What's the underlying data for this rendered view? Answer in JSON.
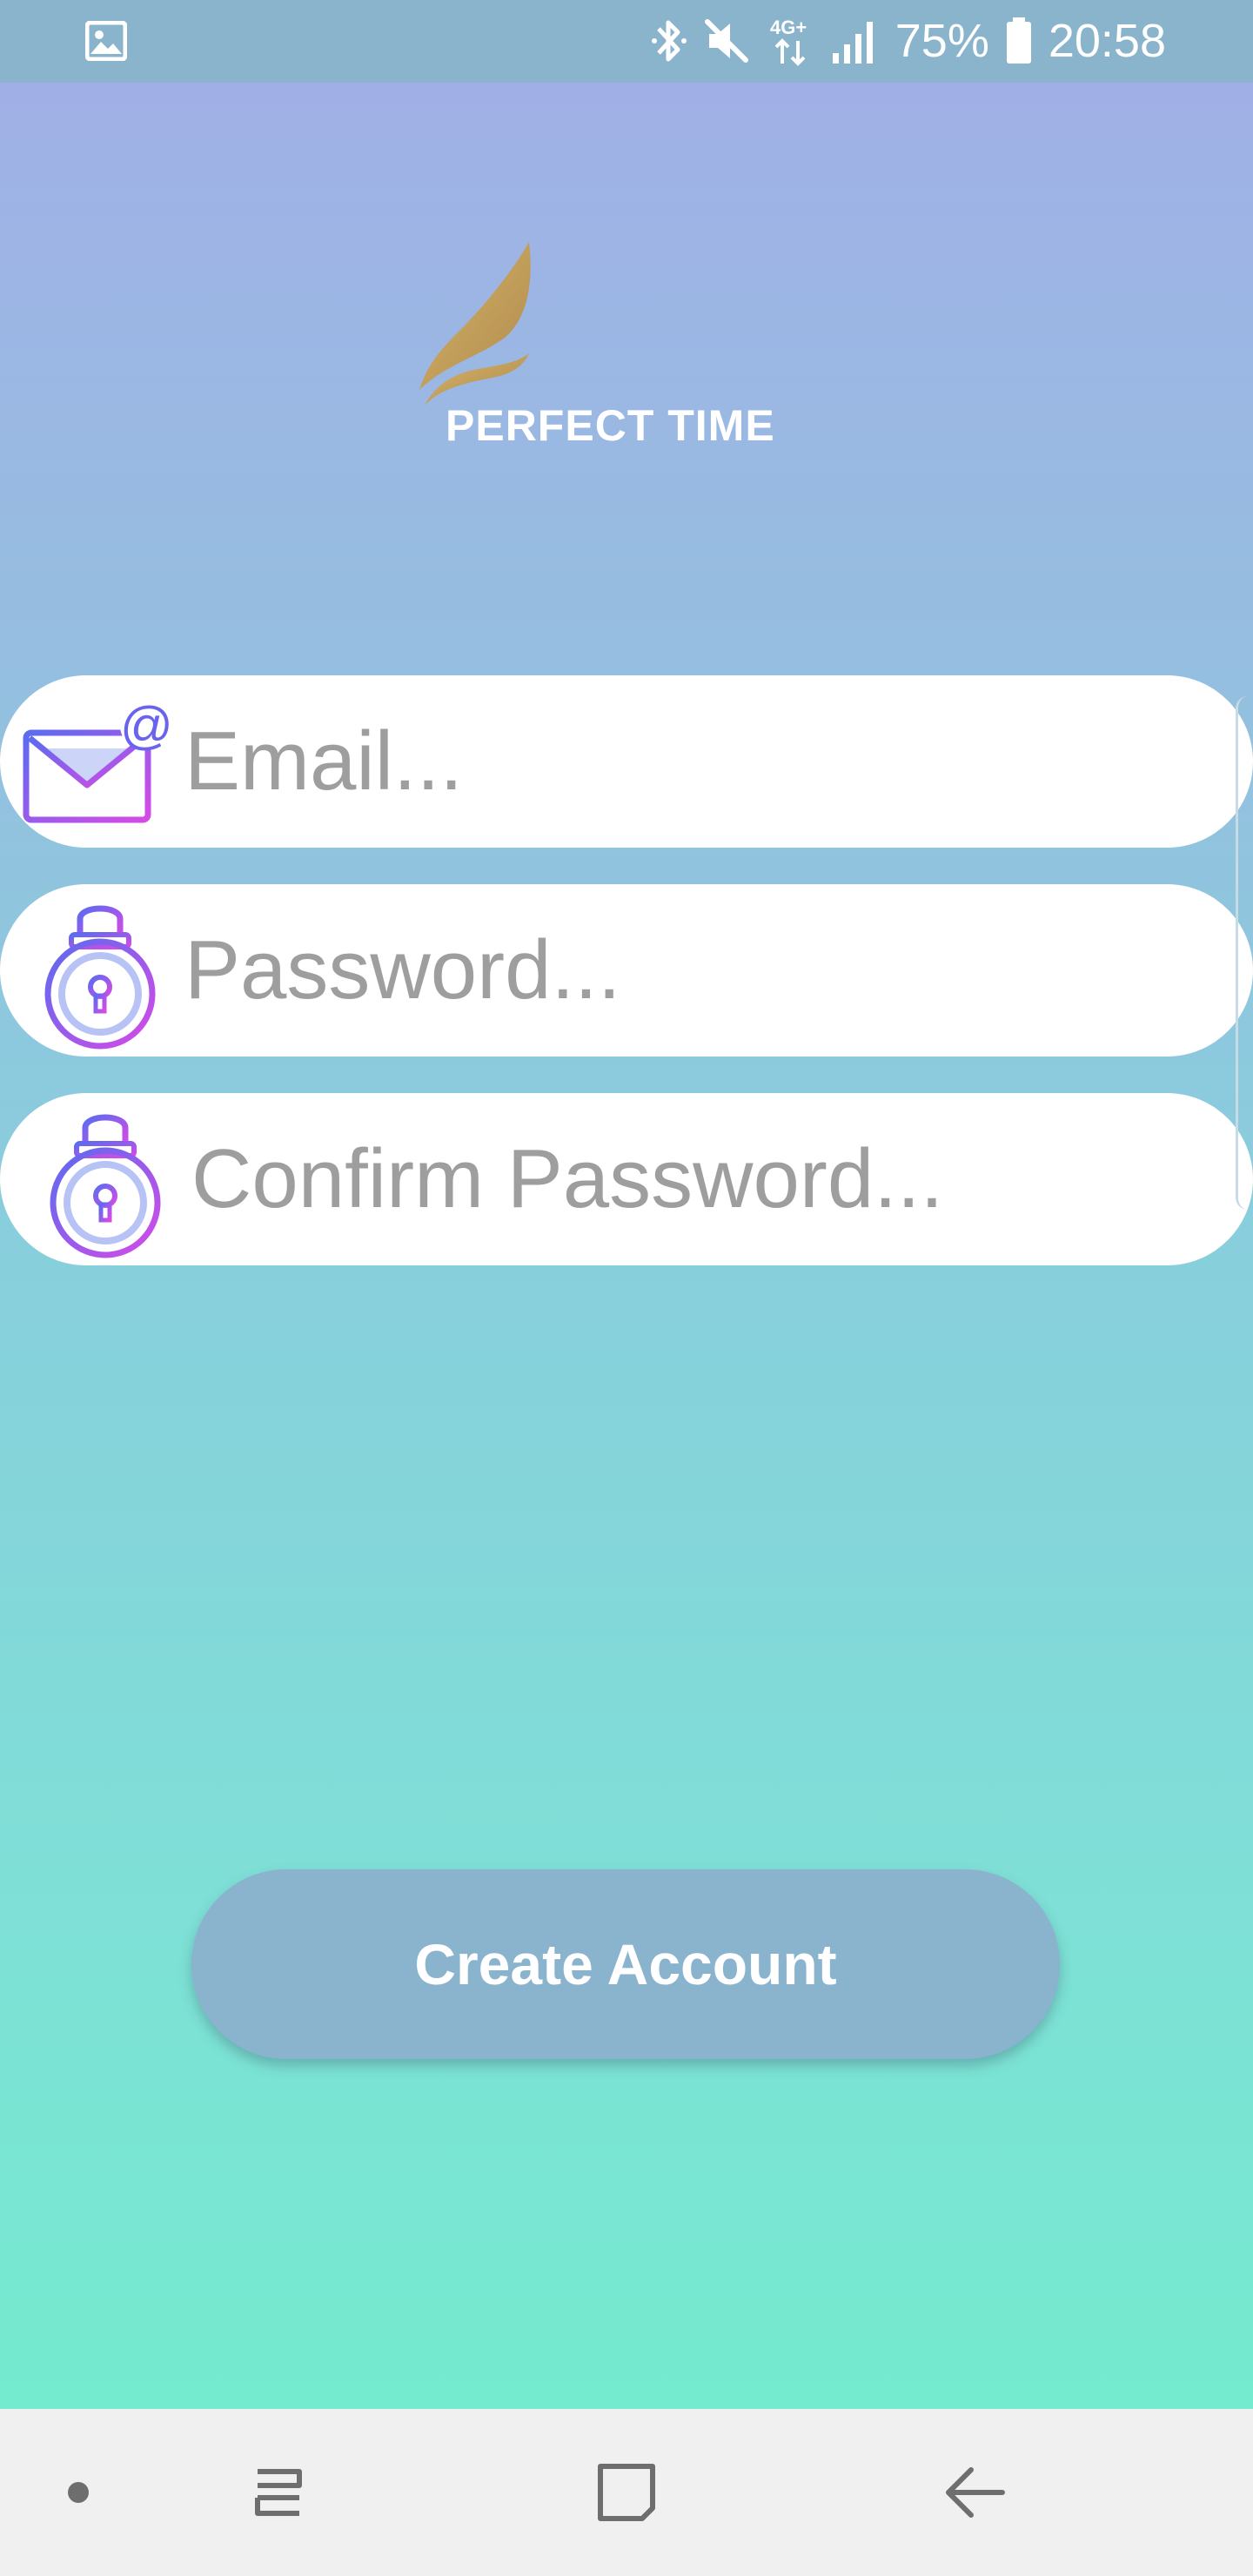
{
  "status_bar": {
    "battery_percent": "75%",
    "time": "20:58",
    "network": "4G+",
    "icons": [
      "gallery-icon",
      "bluetooth-icon",
      "mute-icon",
      "network-4g-icon",
      "signal-icon",
      "battery-icon"
    ]
  },
  "logo": {
    "brand_name": "PERFECT TIME",
    "accent_color": "#c9a35b"
  },
  "form": {
    "email_placeholder": "Email...",
    "password_placeholder": "Password...",
    "confirm_password_placeholder": "Confirm Password..."
  },
  "actions": {
    "create_account_label": "Create Account"
  },
  "nav_bar": {
    "items": [
      "dot-icon",
      "recent-apps-icon",
      "home-icon",
      "back-icon"
    ]
  },
  "colors": {
    "gradient_top": "#a2aee8",
    "gradient_bottom": "#74eacf",
    "button": "#8ab4ce",
    "placeholder_text": "#9e9e9e",
    "icon_gradient_start": "#5b6cf0",
    "icon_gradient_end": "#d64ae6"
  }
}
